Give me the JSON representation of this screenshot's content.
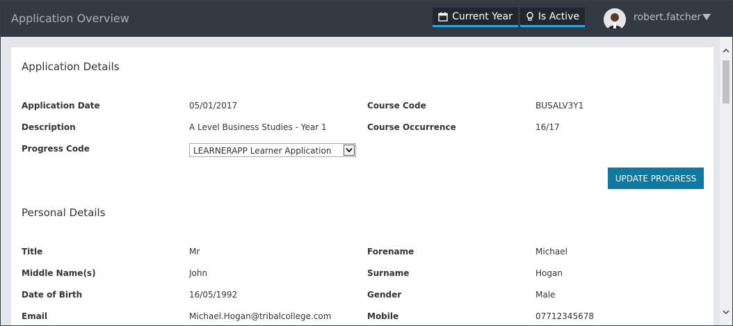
{
  "header": {
    "title": "Application Overview",
    "current_year_label": "Current Year",
    "is_active_label": "Is Active",
    "user_name": "robert.fatcher",
    "accent_color": "#27a8e0"
  },
  "application_details": {
    "title": "Application Details",
    "application_date_label": "Application Date",
    "application_date": "05/01/2017",
    "description_label": "Description",
    "description": "A Level Business Studies - Year 1",
    "progress_code_label": "Progress Code",
    "progress_code_selected": "LEARNERAPP Learner Application",
    "course_code_label": "Course Code",
    "course_code": "BUSALV3Y1",
    "course_occurrence_label": "Course Occurrence",
    "course_occurrence": "16/17",
    "update_button": "UPDATE PROGRESS"
  },
  "personal_details": {
    "title": "Personal Details",
    "title_label": "Title",
    "title_value": "Mr",
    "middle_names_label": "Middle Name(s)",
    "middle_names": "John",
    "dob_label": "Date of Birth",
    "dob": "16/05/1992",
    "email_label": "Email",
    "email": "Michael.Hogan@tribalcollege.com",
    "forename_label": "Forename",
    "forename": "Michael",
    "surname_label": "Surname",
    "surname": "Hogan",
    "gender_label": "Gender",
    "gender": "Male",
    "mobile_label": "Mobile",
    "mobile": "07712345678"
  },
  "icons": {
    "calendar": "calendar-icon",
    "bulb": "lightbulb-icon",
    "user_menu": "caret-down-icon"
  }
}
